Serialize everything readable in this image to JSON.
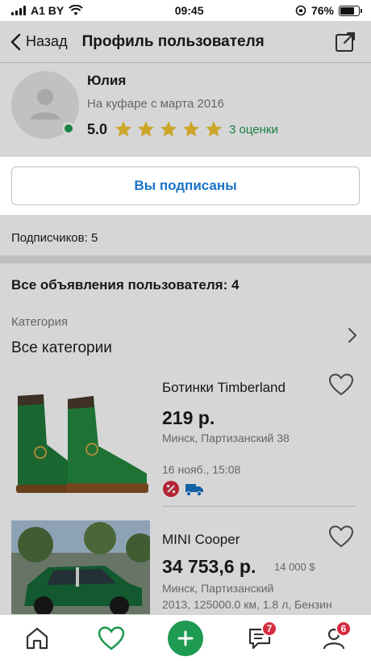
{
  "status_bar": {
    "carrier": "A1 BY",
    "time": "09:45",
    "battery": "76%",
    "battery_level": 0.76
  },
  "navbar": {
    "back_label": "Назад",
    "title": "Профиль пользователя"
  },
  "profile": {
    "name": "Юлия",
    "since": "На куфаре с марта 2016",
    "rating": "5.0",
    "stars": 5,
    "reviews": "3 оценки"
  },
  "subscribe_button": "Вы подписаны",
  "subscribers": "Подписчиков: 5",
  "ads": {
    "title": "Все объявления пользователя: 4",
    "category_label": "Категория",
    "category_value": "Все категории",
    "items": [
      {
        "title": "Ботинки Timberland",
        "price": "219 р.",
        "location": "Минск, Партизанский 38",
        "date": "16 нояб., 15:08",
        "badges": [
          "discount-icon",
          "delivery-truck-icon"
        ]
      },
      {
        "title": "MINI Cooper",
        "price": "34 753,6 р.",
        "price_alt": "14 000 $",
        "location": "Минск, Партизанский",
        "details": "2013, 125000.0 км, 1.8 л, Бензин"
      }
    ]
  },
  "tabbar": {
    "items": [
      {
        "name": "home-icon"
      },
      {
        "name": "heart-icon"
      },
      {
        "name": "plus-icon"
      },
      {
        "name": "chat-icon",
        "badge": "7"
      },
      {
        "name": "profile-icon",
        "badge": "6"
      }
    ]
  },
  "colors": {
    "accent_green": "#1e9a52",
    "link_blue": "#1a73c8",
    "badge_red": "#d72b3f",
    "star_yellow": "#f4c531"
  }
}
